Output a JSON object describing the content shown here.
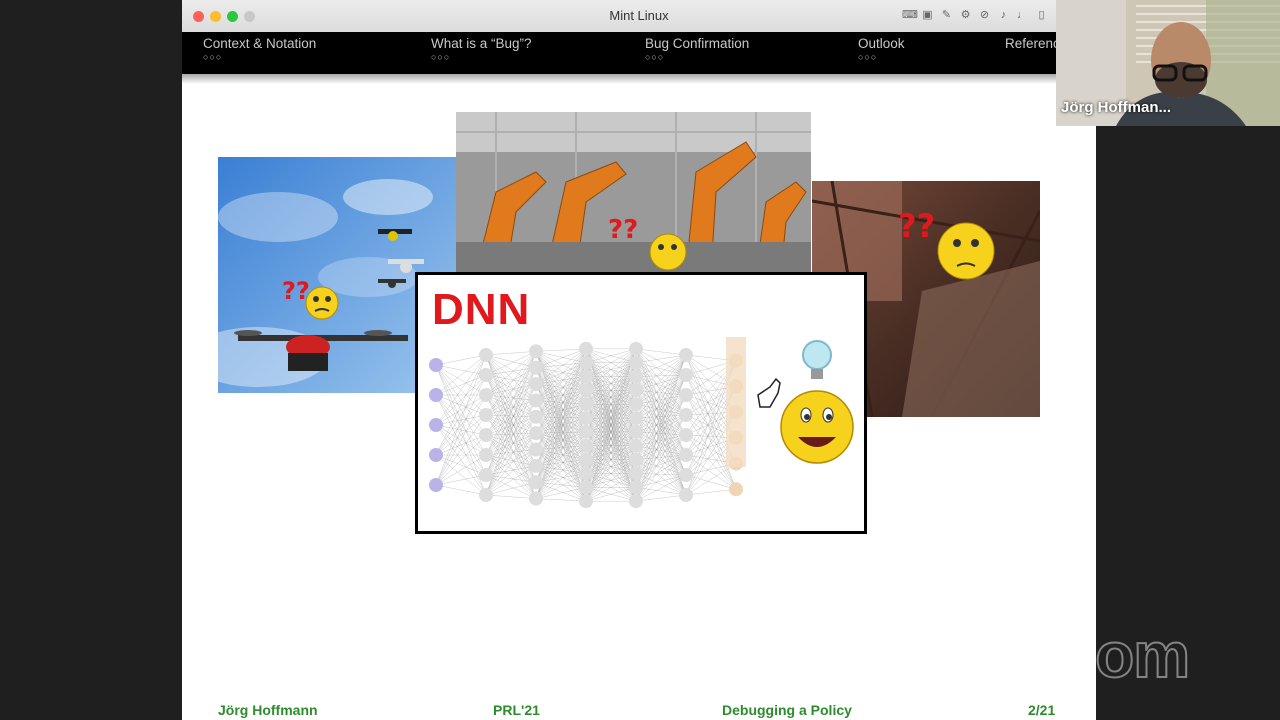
{
  "window": {
    "title": "Mint Linux"
  },
  "toolbar_icons": [
    "keyboard-icon",
    "chip-icon",
    "pen-icon",
    "settings-icon",
    "no-camera-icon",
    "speaker-icon",
    "microphone-icon",
    "tablet-icon",
    "battery-icon",
    "mail-icon"
  ],
  "navigation": [
    {
      "label": "Context & Notation",
      "dots": "○○○"
    },
    {
      "label": "What is a “Bug”?",
      "dots": "○○○"
    },
    {
      "label": "Bug Confirmation",
      "dots": "○○○"
    },
    {
      "label": "Outlook",
      "dots": "○○○"
    },
    {
      "label": "References",
      "dots": ""
    }
  ],
  "slide": {
    "diagram_label": "DNN"
  },
  "footer": {
    "author": "Jörg Hoffmann",
    "venue": "PRL'21",
    "title": "Debugging a Policy",
    "page": "2/21"
  },
  "participant": {
    "name": "Jörg Hoffman..."
  },
  "overlay": {
    "logo": "zoom"
  },
  "colors": {
    "footer": "#2e8b2e",
    "dnn_label": "#e0191f",
    "nav_bg": "#000000"
  }
}
